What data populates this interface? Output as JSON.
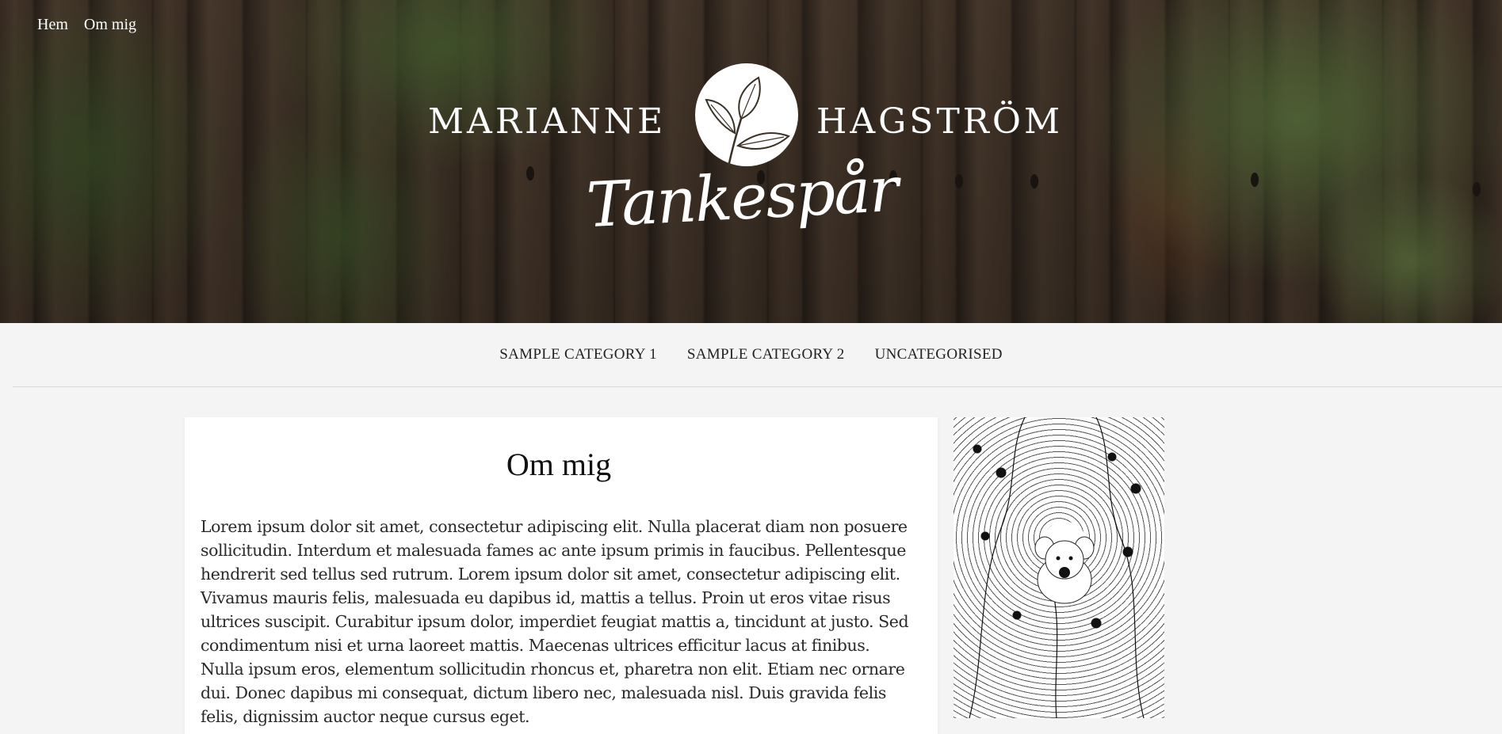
{
  "top_nav": {
    "items": [
      {
        "label": "Hem"
      },
      {
        "label": "Om mig"
      }
    ]
  },
  "brand": {
    "first_name": "MARIANNE",
    "last_name": "HAGSTRÖM",
    "script_title": "Tankespår"
  },
  "category_nav": {
    "items": [
      {
        "label": "SAMPLE CATEGORY 1"
      },
      {
        "label": "SAMPLE CATEGORY 2"
      },
      {
        "label": "UNCATEGORISED"
      }
    ]
  },
  "article": {
    "title": "Om mig",
    "body": "Lorem ipsum dolor sit amet, consectetur adipiscing elit. Nulla placerat diam non posuere sollicitudin. Interdum et malesuada fames ac ante ipsum primis in faucibus. Pellentesque hendrerit sed tellus sed rutrum. Lorem ipsum dolor sit amet, consectetur adipiscing elit. Vivamus mauris felis, malesuada eu dapibus id, mattis a tellus. Proin ut eros vitae risus ultrices suscipit. Curabitur ipsum dolor, imperdiet feugiat mattis a, tincidunt at justo. Sed condimentum nisi et urna laoreet mattis. Maecenas ultrices efficitur lacus at finibus. Nulla ipsum eros, elementum sollicitudin rhoncus et, pharetra non elit. Etiam nec ornare dui. Donec dapibus mi consequat, dictum libero nec, malesuada nisl. Duis gravida felis felis, dignissim auctor neque cursus eget."
  },
  "colors": {
    "page_background": "#f4f4f4",
    "card_background": "#ffffff",
    "text": "#222222",
    "hero_text": "#ffffff"
  },
  "icons": {
    "logo": "leaf-logo-icon"
  }
}
